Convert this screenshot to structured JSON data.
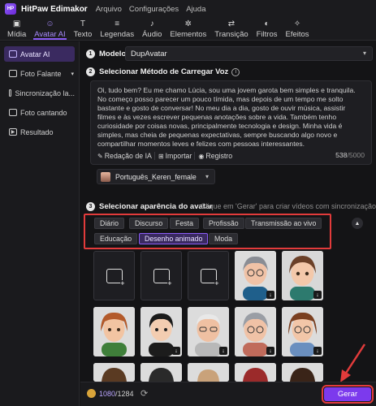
{
  "app": {
    "title": "HitPaw Edimakor",
    "logo_text": "HP"
  },
  "menu": [
    "Arquivo",
    "Configurações",
    "Ajuda"
  ],
  "toolbar": [
    {
      "label": "Mídia",
      "icon": "media-icon",
      "glyph": "▣"
    },
    {
      "label": "Avatar AI",
      "icon": "avatar-ai-icon",
      "glyph": "☺",
      "active": true
    },
    {
      "label": "Texto",
      "icon": "text-icon",
      "glyph": "T"
    },
    {
      "label": "Legendas",
      "icon": "subtitles-icon",
      "glyph": "≡"
    },
    {
      "label": "Áudio",
      "icon": "audio-icon",
      "glyph": "♪"
    },
    {
      "label": "Elementos",
      "icon": "elements-icon",
      "glyph": "✲"
    },
    {
      "label": "Transição",
      "icon": "transition-icon",
      "glyph": "⇄"
    },
    {
      "label": "Filtros",
      "icon": "filters-icon",
      "glyph": "◐"
    },
    {
      "label": "Efeitos",
      "icon": "effects-icon",
      "glyph": "✧"
    }
  ],
  "sidebar": [
    {
      "label": "Avatar AI",
      "active": true
    },
    {
      "label": "Foto Falante",
      "has_chevron": true
    },
    {
      "label": "Sincronização la..."
    },
    {
      "label": "Foto cantando"
    },
    {
      "label": "Resultado"
    }
  ],
  "step1": {
    "num": "1",
    "label": "Modelo",
    "value": "DupAvatar"
  },
  "step2": {
    "num": "2",
    "label": "Selecionar Método de Carregar Voz",
    "text": "Oi, tudo bem? Eu me chamo Lúcia, sou uma jovem garota bem simples e tranquila. No começo posso parecer um pouco tímida, mas depois de um tempo me solto bastante e gosto de conversar! No meu dia a dia, gosto de ouvir música, assistir filmes e às vezes escrever pequenas anotações sobre a vida. Também tenho curiosidade por coisas novas, principalmente tecnologia e design. Minha vida é simples, mas cheia de pequenas expectativas, sempre buscando algo novo e compartilhar momentos leves e felizes com pessoas interessantes.",
    "actions": [
      "Redação de IA",
      "Importar",
      "Registro"
    ],
    "count": "538",
    "max": "/5000",
    "voice": "Português_Keren_female"
  },
  "step3": {
    "num": "3",
    "label": "Selecionar aparência do avatar",
    "hint": "Clique em 'Gerar' para criar vídeos com sincronização...",
    "chips": [
      "Diário",
      "Discurso",
      "Festa",
      "Profissão",
      "Transmissão ao vivo",
      "Educação",
      "Desenho animado",
      "Moda"
    ],
    "active_chip": "Desenho animado"
  },
  "bottom": {
    "used": "1080",
    "total": "/1284",
    "generate": "Gerar"
  },
  "colors": {
    "accent": "#8b5cf6",
    "highlight": "#e23b3b"
  }
}
